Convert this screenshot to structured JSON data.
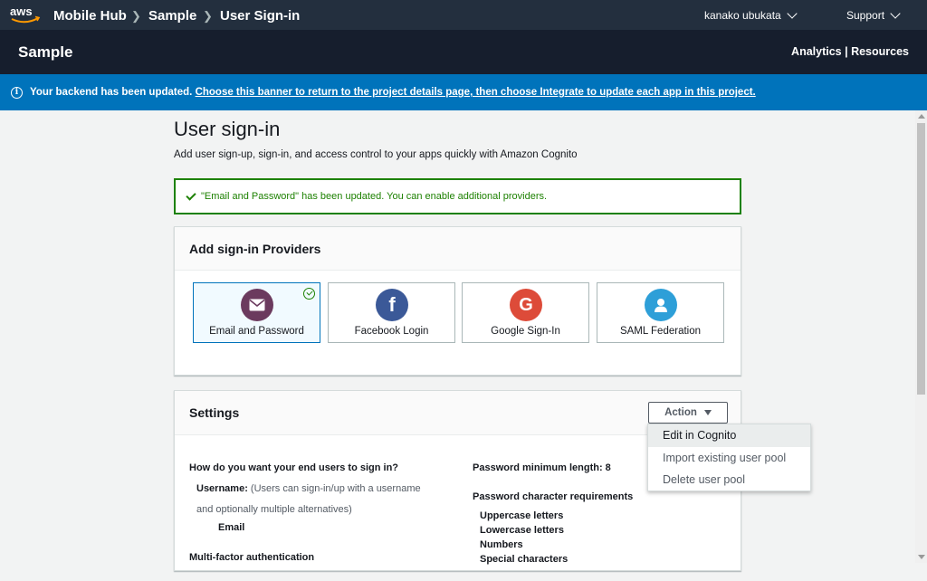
{
  "topbar": {
    "logo": "aws",
    "breadcrumbs": [
      "Mobile Hub",
      "Sample",
      "User Sign-in"
    ],
    "user": "kanako ubukata",
    "support": "Support"
  },
  "project": {
    "title": "Sample",
    "links": "Analytics | Resources"
  },
  "banner": {
    "prefix": "Your backend has been updated. ",
    "link_part1": "Choose this banner to return to the project details page, then choose ",
    "link_bold": "Integrate",
    "link_part2": " to update each app in this project."
  },
  "page": {
    "title": "User sign-in",
    "subtitle": "Add user sign-up, sign-in, and access control to your apps quickly with Amazon Cognito"
  },
  "success_message": "\"Email and Password\" has been updated. You can enable additional providers.",
  "providers": {
    "heading": "Add sign-in Providers",
    "items": [
      {
        "label": "Email and Password",
        "icon": "envelope-icon",
        "color": "#6b3a5e",
        "selected": true
      },
      {
        "label": "Facebook Login",
        "icon": "facebook-icon",
        "color": "#3b5998",
        "selected": false
      },
      {
        "label": "Google Sign-In",
        "icon": "google-icon",
        "color": "#dd4b39",
        "selected": false
      },
      {
        "label": "SAML Federation",
        "icon": "user-icon",
        "color": "#2e9fd8",
        "selected": false
      }
    ]
  },
  "settings": {
    "heading": "Settings",
    "action_label": "Action",
    "question": "How do you want your end users to sign in?",
    "username_label": "Username:",
    "username_desc1": " (Users can sign-in/up with a username",
    "username_desc2": "and optionally multiple alternatives)",
    "email": "Email",
    "mfa": "Multi-factor authentication",
    "pw_min": "Password minimum length: 8",
    "pw_req": "Password character requirements",
    "req_items": [
      "Uppercase letters",
      "Lowercase letters",
      "Numbers",
      "Special characters"
    ]
  },
  "dropdown": {
    "items": [
      "Edit in Cognito",
      "Import existing user pool",
      "Delete user pool"
    ]
  },
  "colors": {
    "topbar": "#232f3e",
    "banner": "#0073bb",
    "success": "#1d8102"
  }
}
